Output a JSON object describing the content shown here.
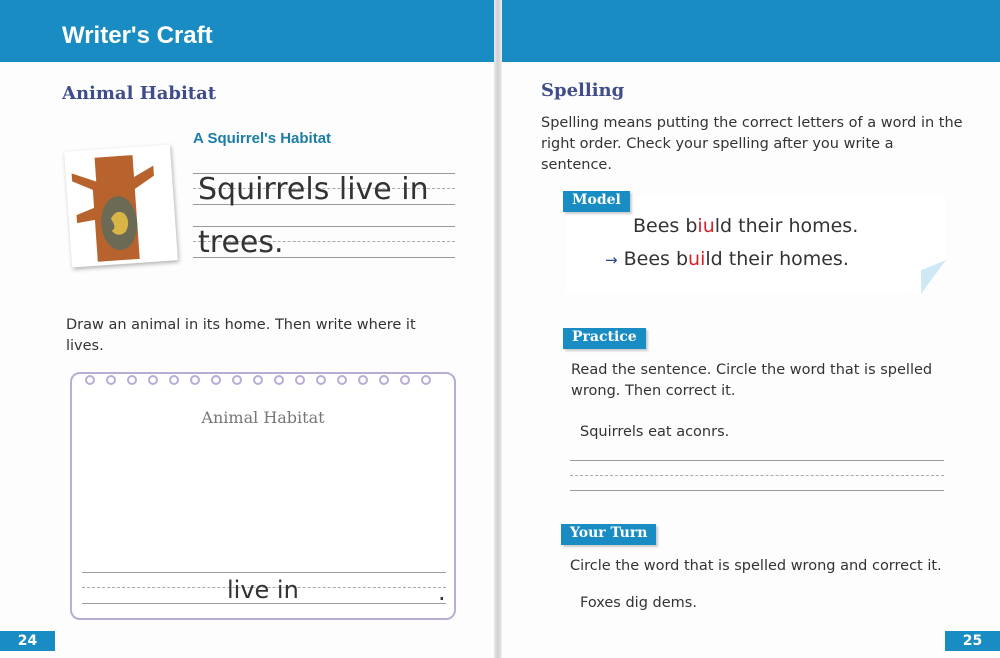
{
  "left_page": {
    "header_title": "Writer's Craft",
    "section_title": "Animal Habitat",
    "example_title": "A Squirrel's Habitat",
    "example_line1": "Squirrels live in",
    "example_line2": "trees.",
    "image": "squirrel-in-tree-icon",
    "instructions": "Draw an animal in its home. Then write where it lives.",
    "notebook_title": "Animal Habitat",
    "notebook_prompt": "live in",
    "notebook_end": ".",
    "page_number": "24"
  },
  "right_page": {
    "section_title": "Spelling",
    "intro": "Spelling means putting the correct letters of a word in the right order. Check your spelling after you write a sentence.",
    "model": {
      "label": "Model",
      "wrong": {
        "pre": "Bees b",
        "hl": "iu",
        "post": "ld their homes."
      },
      "arrow": "→",
      "right": {
        "pre": "Bees b",
        "hl": "ui",
        "post": "ld their homes."
      }
    },
    "practice": {
      "label": "Practice",
      "instructions": "Read the sentence. Circle the word that is spelled wrong. Then correct it.",
      "sentence": "Squirrels eat aconrs."
    },
    "your_turn": {
      "label": "Your Turn",
      "instructions": "Circle the word that is spelled wrong and correct it.",
      "sentence": "Foxes dig dems."
    },
    "page_number": "25"
  },
  "colors": {
    "accent": "#1a8cc4",
    "heading": "#3f4d8a",
    "highlight": "#d8222a",
    "notebook": "#b9acd6"
  }
}
